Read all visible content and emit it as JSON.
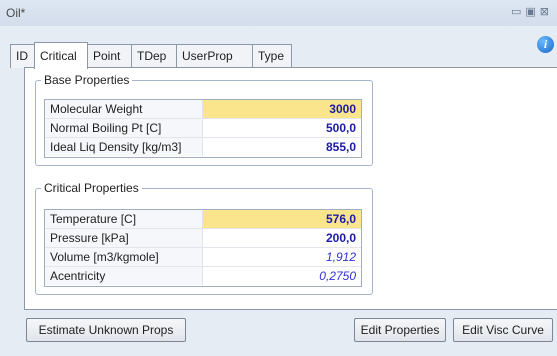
{
  "window": {
    "title": "Oil*"
  },
  "tabs": [
    "ID",
    "Critical",
    "Point",
    "TDep",
    "UserProp",
    "Type"
  ],
  "base_properties": {
    "title": "Base Properties",
    "rows": [
      {
        "label": "Molecular Weight",
        "value": "3000"
      },
      {
        "label": "Normal Boiling Pt [C]",
        "value": "500,0"
      },
      {
        "label": "Ideal Liq Density [kg/m3]",
        "value": "855,0"
      }
    ]
  },
  "critical_properties": {
    "title": "Critical Properties",
    "rows": [
      {
        "label": "Temperature [C]",
        "value": "576,0"
      },
      {
        "label": "Pressure [kPa]",
        "value": "200,0"
      },
      {
        "label": "Volume [m3/kgmole]",
        "value": "1,912"
      },
      {
        "label": "Acentricity",
        "value": "0,2750"
      }
    ]
  },
  "buttons": {
    "estimate": "Estimate Unknown Props",
    "edit_properties": "Edit Properties",
    "edit_visc_curve": "Edit Visc Curve"
  },
  "colors": {
    "highlight": "#fbe58c",
    "value_blue": "#1a1aa8"
  }
}
